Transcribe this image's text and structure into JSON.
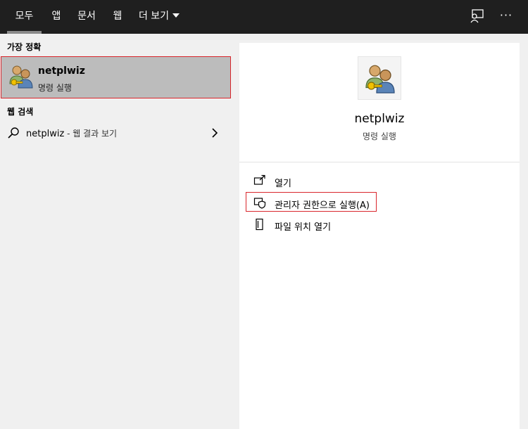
{
  "topbar": {
    "tabs": [
      {
        "label": "모두",
        "active": true
      },
      {
        "label": "앱"
      },
      {
        "label": "문서"
      },
      {
        "label": "웹"
      },
      {
        "label": "더 보기"
      }
    ],
    "feedback_icon": "feedback-person-icon",
    "more_options": "···"
  },
  "left": {
    "best_match_header": "가장 정확",
    "best_match": {
      "title": "netplwiz",
      "subtitle": "명령 실행",
      "icon": "users-keys-icon"
    },
    "web_header": "웹 검색",
    "web_row": {
      "query": "netplwiz",
      "suffix": " - 웹 결과 보기",
      "icon": "search-icon"
    }
  },
  "right": {
    "app_name": "netplwiz",
    "app_type": "명령 실행",
    "actions": [
      {
        "label": "열기",
        "icon": "open-icon"
      },
      {
        "label": "관리자 권한으로 실행(A)",
        "icon": "shield-icon"
      },
      {
        "label": "파일 위치 열기",
        "icon": "file-location-icon"
      }
    ]
  },
  "colors": {
    "topbar_bg": "#1f1f1f",
    "highlight_border": "#d9262c",
    "selected_bg": "#bcbcbc",
    "pane_bg": "#f0f0f0",
    "detail_bg": "#ffffff"
  }
}
